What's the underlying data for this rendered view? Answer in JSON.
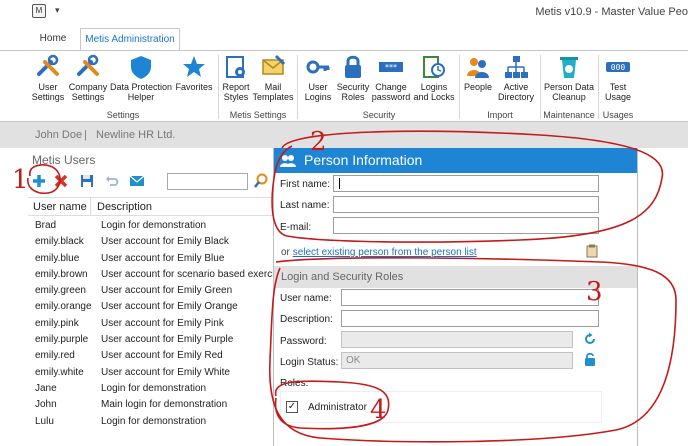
{
  "window": {
    "app_badge": "M",
    "quick_access": "▾",
    "title": "Metis v10.9 - Master Value Peo"
  },
  "tabs": [
    {
      "label": "Home"
    },
    {
      "label": "Metis Administration"
    }
  ],
  "ribbon": {
    "buttons": [
      {
        "line1": "User",
        "line2": "Settings",
        "icon": "tools-icon"
      },
      {
        "line1": "Company",
        "line2": "Settings",
        "icon": "tools-icon"
      },
      {
        "line1": "Data Protection",
        "line2": "Helper",
        "icon": "shield-icon"
      },
      {
        "line1": "Favorites",
        "line2": "",
        "icon": "star-icon"
      },
      {
        "line1": "Report",
        "line2": "Styles",
        "icon": "report-gear-icon"
      },
      {
        "line1": "Mail",
        "line2": "Templates",
        "icon": "mail-template-icon"
      },
      {
        "line1": "User",
        "line2": "Logins",
        "icon": "key-icon"
      },
      {
        "line1": "Security",
        "line2": "Roles",
        "icon": "lock-icon"
      },
      {
        "line1": "Change",
        "line2": "password",
        "icon": "password-icon"
      },
      {
        "line1": "Logins",
        "line2": "and Locks",
        "icon": "clock-log-icon"
      },
      {
        "line1": "People",
        "line2": "",
        "icon": "people-icon"
      },
      {
        "line1": "Active",
        "line2": "Directory",
        "icon": "directory-icon"
      },
      {
        "line1": "Person Data",
        "line2": "Cleanup",
        "icon": "bin-icon"
      },
      {
        "line1": "Test",
        "line2": "Usage",
        "icon": "counter-icon"
      }
    ],
    "groups": [
      {
        "label": "Settings"
      },
      {
        "label": "Metis Settings"
      },
      {
        "label": "Security"
      },
      {
        "label": "Import"
      },
      {
        "label": "Maintenance"
      },
      {
        "label": "Usages"
      }
    ]
  },
  "userstrip": {
    "user": "John Doe",
    "separator": "|",
    "company": "Newline HR Ltd."
  },
  "users_panel": {
    "title": "Metis Users",
    "columns": [
      "User name",
      "Description"
    ],
    "rows": [
      {
        "name": "Brad",
        "desc": "Login for demonstration"
      },
      {
        "name": "emily.black",
        "desc": "User account for Emily Black"
      },
      {
        "name": "emily.blue",
        "desc": "User account for Emily Blue"
      },
      {
        "name": "emily.brown",
        "desc": "User account for scenario based exercis"
      },
      {
        "name": "emily.green",
        "desc": "User account for Emily Green"
      },
      {
        "name": "emily.orange",
        "desc": "User account for Emily Orange"
      },
      {
        "name": "emily.pink",
        "desc": "User account for Emily Pink"
      },
      {
        "name": "emily.purple",
        "desc": "User account for Emily Purple"
      },
      {
        "name": "emily.red",
        "desc": "User account for Emily Red"
      },
      {
        "name": "emily.white",
        "desc": "User account for Emily White"
      },
      {
        "name": "Jane",
        "desc": "Login for demonstration"
      },
      {
        "name": "John",
        "desc": "Main login for demonstration"
      },
      {
        "name": "Lulu",
        "desc": "Login for demonstration"
      }
    ]
  },
  "dialog": {
    "title": "Person Information",
    "first_name_label": "First name:",
    "last_name_label": "Last name:",
    "email_label": "E-mail:",
    "link_prefix": "or",
    "link_text": "select existing person from the person list",
    "section_title": "Login and Security Roles",
    "username_label": "User name:",
    "description_label": "Description:",
    "password_label": "Password:",
    "login_status_label": "Login Status:",
    "login_status_value": "OK",
    "roles_label": "Roles:",
    "role_checkbox_mark": "✓",
    "role_name": "Administrator"
  },
  "annotations": {
    "one": "1",
    "two": "2",
    "three": "3",
    "four": "4"
  },
  "colors": {
    "accent": "#1e84d4",
    "annotation": "#c41a1a",
    "add": "#1f8fd0",
    "delete": "#d4332a"
  }
}
